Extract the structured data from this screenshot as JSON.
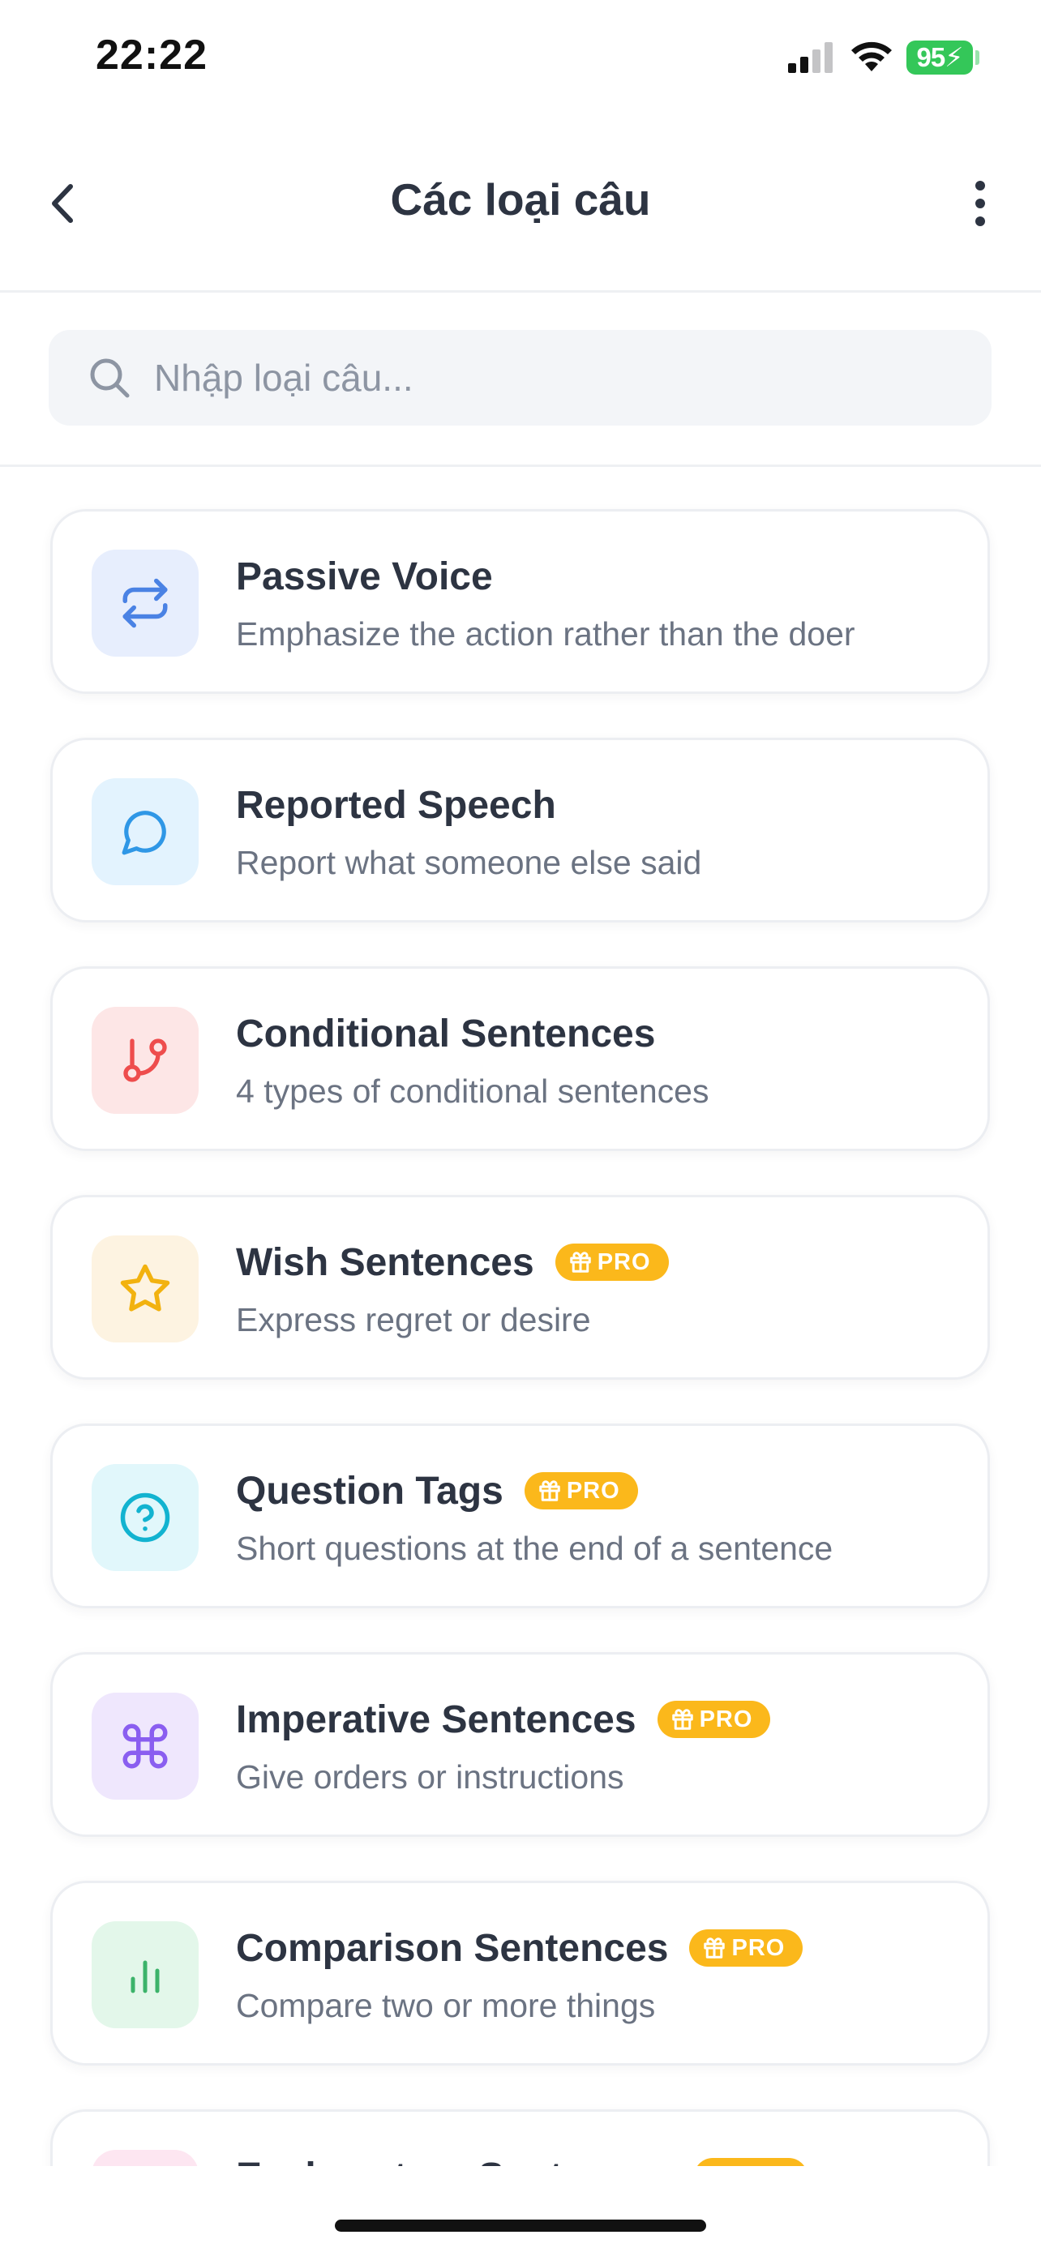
{
  "status_bar": {
    "time": "22:22",
    "battery": "95"
  },
  "header": {
    "title": "Các loại câu",
    "back_icon": "chevron-left-icon",
    "more_icon": "more-vertical-icon"
  },
  "search": {
    "placeholder": "Nhập loại câu...",
    "value": "",
    "icon": "search-icon"
  },
  "colors": {
    "pro_badge": "#fbb81b",
    "title_text": "#2d3442",
    "desc_text": "#6b7382"
  },
  "sentence_types": [
    {
      "title": "Passive Voice",
      "description": "Emphasize the action rather than the doer",
      "icon": "repeat-arrows-icon",
      "icon_color": "#4a82e4",
      "icon_bg": "#e7eefd",
      "pro": false
    },
    {
      "title": "Reported Speech",
      "description": "Report what someone else said",
      "icon": "chat-bubble-icon",
      "icon_color": "#2f97e6",
      "icon_bg": "#e3f3fe",
      "pro": false
    },
    {
      "title": "Conditional Sentences",
      "description": "4 types of conditional sentences",
      "icon": "git-branch-icon",
      "icon_color": "#ee4d4d",
      "icon_bg": "#fde6e6",
      "pro": false
    },
    {
      "title": "Wish Sentences",
      "description": "Express regret or desire",
      "icon": "star-icon",
      "icon_color": "#f2b20f",
      "icon_bg": "#fdf3e1",
      "pro": true,
      "badge": "PRO"
    },
    {
      "title": "Question Tags",
      "description": "Short questions at the end of a sentence",
      "icon": "help-circle-icon",
      "icon_color": "#12b3d0",
      "icon_bg": "#e1f7fb",
      "pro": true,
      "badge": "PRO"
    },
    {
      "title": "Imperative Sentences",
      "description": "Give orders or instructions",
      "icon": "command-icon",
      "icon_color": "#8a5ef0",
      "icon_bg": "#efe7fd",
      "pro": true,
      "badge": "PRO"
    },
    {
      "title": "Comparison Sentences",
      "description": "Compare two or more things",
      "icon": "bar-chart-icon",
      "icon_color": "#3cb36a",
      "icon_bg": "#e3f7ea",
      "pro": true,
      "badge": "PRO"
    },
    {
      "title": "Exclamatory Sentences",
      "description": "",
      "icon": "exclamation-icon",
      "icon_color": "#e35a9a",
      "icon_bg": "#fde6f1",
      "pro": true,
      "badge": "PRO"
    }
  ]
}
